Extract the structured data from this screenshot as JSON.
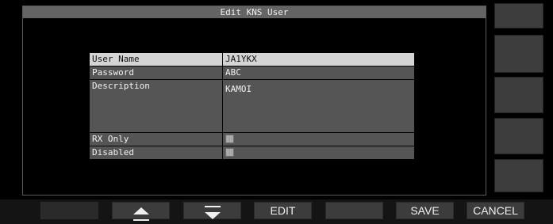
{
  "window": {
    "title": "Edit KNS User"
  },
  "form": {
    "rows": [
      {
        "label": "User Name",
        "value": "JA1YKX"
      },
      {
        "label": "Password",
        "value": "ABC"
      },
      {
        "label": "Description",
        "value": "KAMOI"
      },
      {
        "label": "RX Only",
        "checked": false
      },
      {
        "label": "Disabled",
        "checked": false
      }
    ]
  },
  "function_keys": {
    "f1": "",
    "f2_icon": "triangle-up-icon",
    "f3_icon": "triangle-down-icon",
    "f4": "EDIT",
    "f5": "",
    "f6": "SAVE",
    "f7": "CANCEL"
  },
  "colors": {
    "title_bar": "#646464",
    "row_bg": "#555555",
    "selected_row_bg": "#d4d4d4"
  }
}
